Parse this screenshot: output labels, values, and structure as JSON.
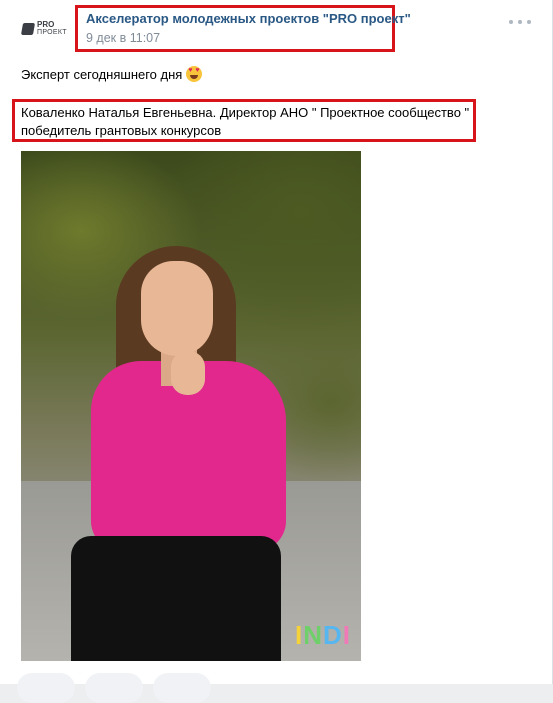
{
  "post": {
    "author": "Акселератор молодежных проектов \"PRO проект\"",
    "date": "9 дек в 11:07",
    "avatar": {
      "line1": "PRO",
      "line2": "ПРОЕКТ"
    },
    "text_line1": "Эксперт сегодняшнего дня",
    "text_quote": "Коваленко Наталья Евгеньевна. Директор АНО \" Проектное сообщество \" победитель грантовых конкурсов",
    "photo_watermark": [
      "I",
      "N",
      "D",
      "I"
    ]
  },
  "colors": {
    "highlight": "#d8141b",
    "link": "#2a5885",
    "meta": "#818c99"
  }
}
